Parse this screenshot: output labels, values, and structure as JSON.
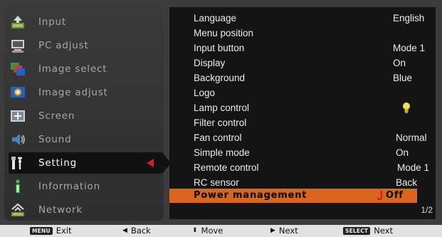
{
  "menu": {
    "items": [
      {
        "label": "Input",
        "icon": "input-icon"
      },
      {
        "label": "PC adjust",
        "icon": "pc-adjust-icon"
      },
      {
        "label": "Image select",
        "icon": "image-select-icon"
      },
      {
        "label": "Image adjust",
        "icon": "image-adjust-icon"
      },
      {
        "label": "Screen",
        "icon": "screen-icon"
      },
      {
        "label": "Sound",
        "icon": "sound-icon"
      },
      {
        "label": "Setting",
        "icon": "setting-icon"
      },
      {
        "label": "Information",
        "icon": "information-icon"
      },
      {
        "label": "Network",
        "icon": "network-icon"
      }
    ],
    "active_index": 6
  },
  "settings": {
    "rows": [
      {
        "name": "Language",
        "value": "English"
      },
      {
        "name": "Menu position",
        "value": ""
      },
      {
        "name": "Input button",
        "value": "Mode 1"
      },
      {
        "name": "Display",
        "value": "On"
      },
      {
        "name": "Background",
        "value": "Blue"
      },
      {
        "name": "Logo",
        "value": ""
      },
      {
        "name": "Lamp control",
        "value": "",
        "value_icon": "lamp-bulb-icon"
      },
      {
        "name": "Filter control",
        "value": ""
      },
      {
        "name": "Fan control",
        "value": "Normal"
      },
      {
        "name": "Simple mode",
        "value": "On"
      },
      {
        "name": "Remote control",
        "value": "Mode 1"
      },
      {
        "name": "RC sensor",
        "value": "Back"
      },
      {
        "name": "Power management",
        "value": "Off"
      }
    ],
    "selected_index": 12,
    "page": "1/2"
  },
  "footer": {
    "exit_key": "MENU",
    "exit": "Exit",
    "back": "Back",
    "move": "Move",
    "next": "Next",
    "select_key": "SELECT",
    "select_next": "Next"
  },
  "colors": {
    "highlight": "#d9661c",
    "marker": "#e01818",
    "panel": "#141414"
  }
}
